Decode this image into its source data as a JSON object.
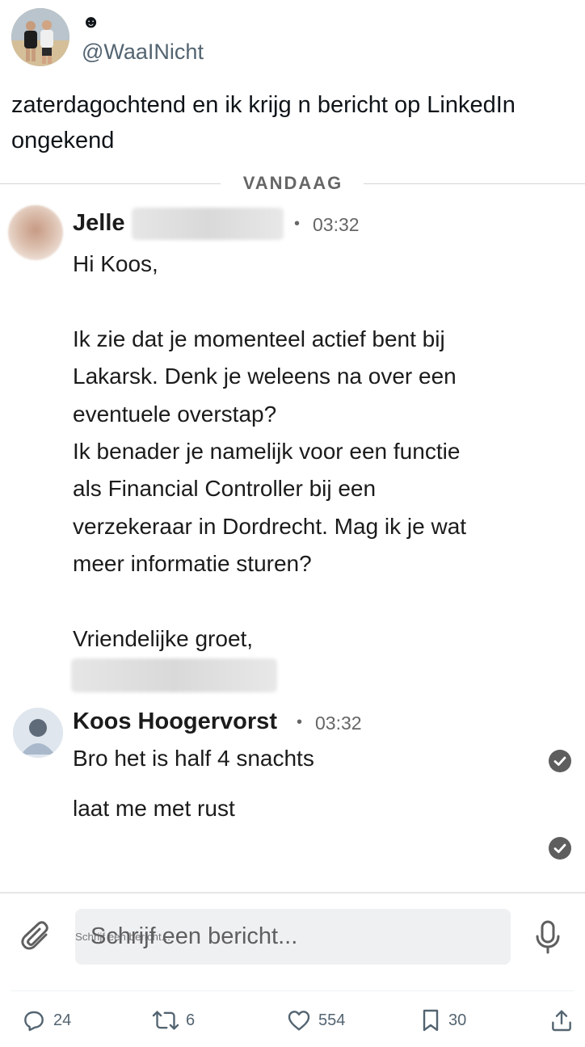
{
  "tweet": {
    "author_emoji": "☻",
    "handle": "@WaaINicht",
    "text_line1": "zaterdagochtend en ik krijg n bericht op LinkedIn",
    "text_line2": "ongekend"
  },
  "conversation": {
    "date_divider": "VANDAAG",
    "message1": {
      "sender_first_name": "Jelle",
      "time": "03:32",
      "body_lines": [
        "Hi Koos,",
        "",
        "Ik zie dat je momenteel actief bent bij",
        "Lakarsk. Denk je weleens na over een",
        "eventuele overstap?",
        "Ik benader je namelijk voor een functie",
        "als Financial Controller bij een",
        "verzekeraar in Dordrecht. Mag ik je wat",
        "meer informatie sturen?",
        "",
        "Vriendelijke groet,"
      ]
    },
    "message2": {
      "sender_name": "Koos Hoogervorst",
      "time": "03:32",
      "reply1": "Bro het is half 4 snachts",
      "reply2": "laat me met rust"
    },
    "compose": {
      "placeholder": "Schrijf een bericht..."
    }
  },
  "actions": {
    "replies": "24",
    "reposts": "6",
    "likes": "554",
    "bookmarks": "30"
  },
  "colors": {
    "text_primary": "#0f1419",
    "text_secondary": "#536471",
    "linkedin_text": "#1b1b1b",
    "check_grey": "#5e5e5e"
  }
}
